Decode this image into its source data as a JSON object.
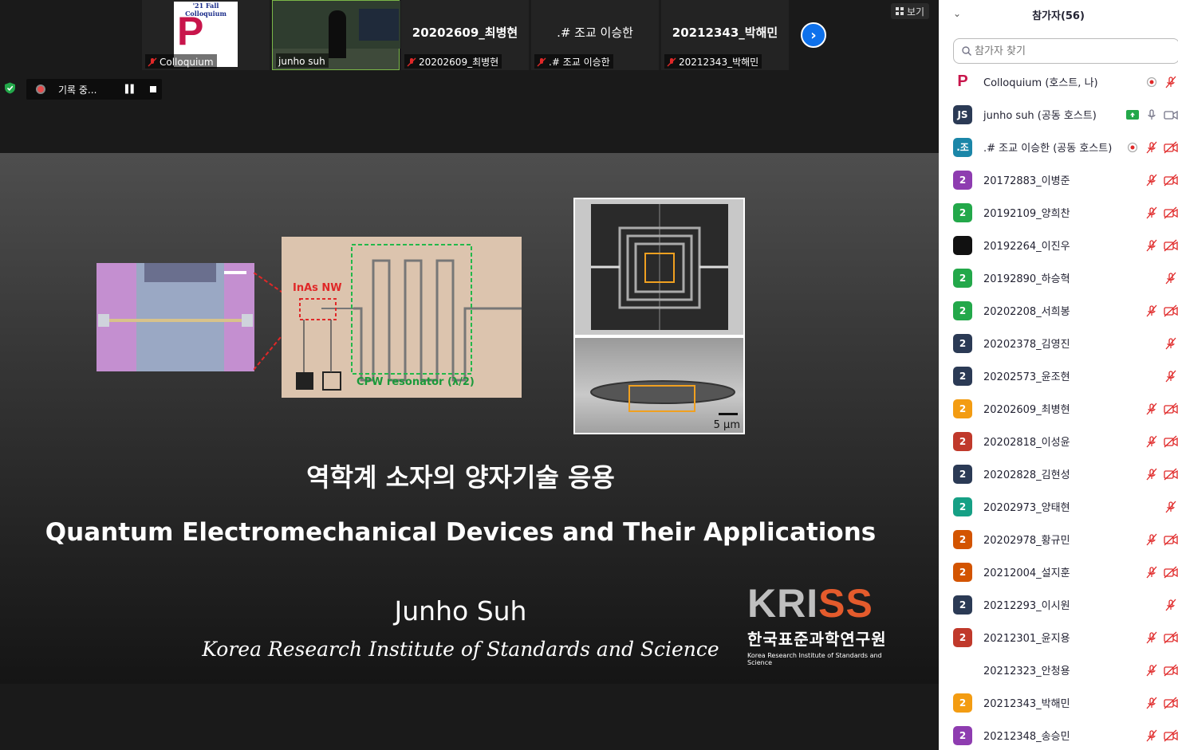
{
  "video_strip": {
    "tiles": [
      {
        "label": "Colloquium",
        "muted": true
      },
      {
        "label": "junho suh",
        "muted": false
      },
      {
        "name": "20202609_최병현",
        "label": "20202609_최병현",
        "muted": true
      },
      {
        "name": ".# 조교 이승한",
        "label": ".# 조교 이승한",
        "muted": true
      },
      {
        "name": "20212343_박해민",
        "label": "20212343_박해민",
        "muted": true
      }
    ],
    "logo_text": "'21 Fall Colloquium",
    "view_label": "보기"
  },
  "recording": {
    "label": "기록 중..."
  },
  "slide": {
    "title_ko": "역학계 소자의 양자기술 응용",
    "title_en": "Quantum Electromechanical Devices and Their Applications",
    "author": "Junho Suh",
    "institution": "Korea Research Institute of Standards and Science",
    "fig_label_nw": "InAs NW",
    "fig_label_cpw": "CPW resonator (λ/2)",
    "fig_scale": "5 μm",
    "kriss_logo": "KRISS",
    "kriss_ko": "한국표준과학연구원",
    "kriss_en": "Korea Research Institute of Standards and Science"
  },
  "sidebar": {
    "title": "참가자(56)",
    "search_placeholder": "참가자 찾기",
    "participants": [
      {
        "avatar": "P",
        "color": "#c8154b",
        "name": "Colloquium (호스트, 나)",
        "icons": [
          "rec",
          "mic-off"
        ]
      },
      {
        "avatar": "JS",
        "color": "#2b3a55",
        "name": "junho suh (공동 호스트)",
        "icons": [
          "share",
          "mic",
          "cam"
        ]
      },
      {
        "avatar": ".조",
        "color": "#1b86a8",
        "name": ".# 조교 이승한 (공동 호스트)",
        "icons": [
          "rec",
          "mic-off",
          "cam-off"
        ]
      },
      {
        "avatar": "2",
        "color": "#8e3cb0",
        "name": "20172883_이병준",
        "icons": [
          "mic-off",
          "cam-off"
        ]
      },
      {
        "avatar": "2",
        "color": "#23a84a",
        "name": "20192109_양희찬",
        "icons": [
          "mic-off",
          "cam-off"
        ]
      },
      {
        "avatar": "",
        "color": "#111111",
        "name": "20192264_이진우",
        "icons": [
          "mic-off",
          "cam-off"
        ]
      },
      {
        "avatar": "2",
        "color": "#23a84a",
        "name": "20192890_하승혁",
        "icons": [
          "mic-off"
        ]
      },
      {
        "avatar": "2",
        "color": "#23a84a",
        "name": "20202208_서희봉",
        "icons": [
          "mic-off",
          "cam-off"
        ]
      },
      {
        "avatar": "2",
        "color": "#2b3a55",
        "name": "20202378_김영진",
        "icons": [
          "mic-off"
        ]
      },
      {
        "avatar": "2",
        "color": "#2b3a55",
        "name": "20202573_윤조현",
        "icons": [
          "mic-off"
        ]
      },
      {
        "avatar": "2",
        "color": "#f39c12",
        "name": "20202609_최병현",
        "icons": [
          "mic-off",
          "cam-off"
        ]
      },
      {
        "avatar": "2",
        "color": "#c0392b",
        "name": "20202818_이성윤",
        "icons": [
          "mic-off",
          "cam-off"
        ]
      },
      {
        "avatar": "2",
        "color": "#2b3a55",
        "name": "20202828_김현성",
        "icons": [
          "mic-off",
          "cam-off"
        ]
      },
      {
        "avatar": "2",
        "color": "#16a085",
        "name": "20202973_양태현",
        "icons": [
          "mic-off"
        ]
      },
      {
        "avatar": "2",
        "color": "#d35400",
        "name": "20202978_황규민",
        "icons": [
          "mic-off",
          "cam-off"
        ]
      },
      {
        "avatar": "2",
        "color": "#d35400",
        "name": "20212004_설지훈",
        "icons": [
          "mic-off",
          "cam-off"
        ]
      },
      {
        "avatar": "2",
        "color": "#2b3a55",
        "name": "20212293_이시원",
        "icons": [
          "mic-off"
        ]
      },
      {
        "avatar": "2",
        "color": "#c0392b",
        "name": "20212301_윤지용",
        "icons": [
          "mic-off",
          "cam-off"
        ]
      },
      {
        "avatar": "",
        "color": "#ffffff",
        "name": "20212323_안청용",
        "icons": [
          "mic-off",
          "cam-off"
        ]
      },
      {
        "avatar": "2",
        "color": "#f39c12",
        "name": "20212343_박해민",
        "icons": [
          "mic-off",
          "cam-off"
        ]
      },
      {
        "avatar": "2",
        "color": "#8e3cb0",
        "name": "20212348_송승민",
        "icons": [
          "mic-off",
          "cam-off"
        ]
      }
    ]
  }
}
